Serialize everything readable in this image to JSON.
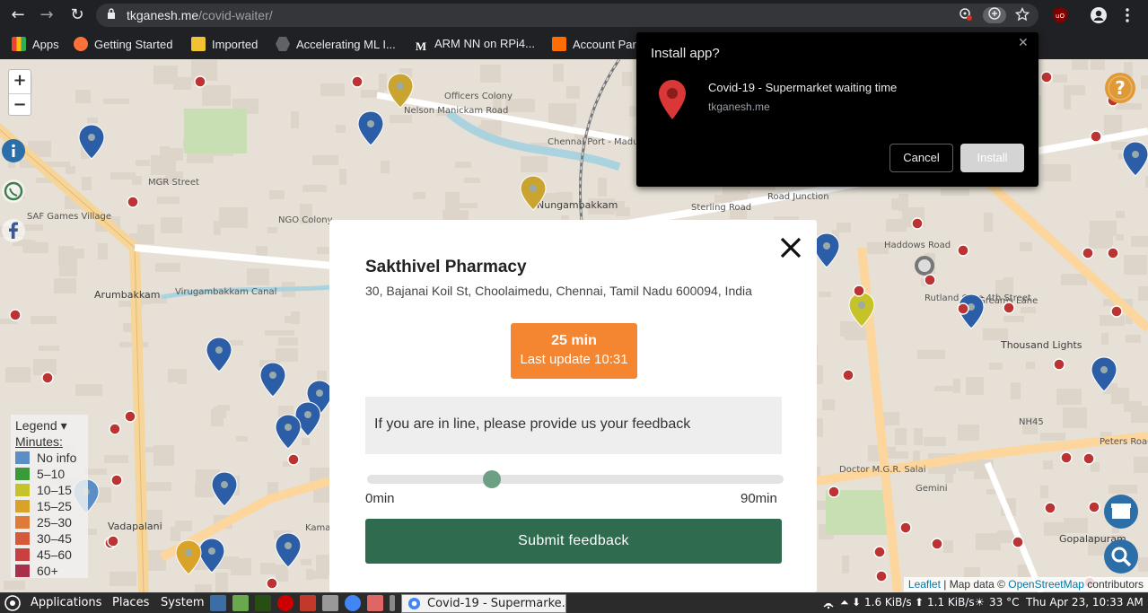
{
  "browser": {
    "url_domain": "tkganesh.me",
    "url_path": "/covid-waiter/",
    "nav": {
      "back": "←",
      "forward": "→",
      "reload": "↻"
    },
    "bookmarks": [
      {
        "label": "Apps",
        "color": "#e8eaed"
      },
      {
        "label": "Getting Started",
        "color": "#ff7139"
      },
      {
        "label": "Imported",
        "color": "#f1c232"
      },
      {
        "label": "Accelerating ML I...",
        "color": "#9aa0a6"
      },
      {
        "label": "ARM NN on RPi4...",
        "color": "#ffffff"
      },
      {
        "label": "Account Par",
        "color": "#ff6d00"
      }
    ]
  },
  "map": {
    "zoom_in": "+",
    "zoom_out": "−",
    "labels": [
      "Officers Colony",
      "Nelson Manickam Road",
      "Chennai Port - Maduravoyal Elevated Expressway",
      "MGR Street",
      "NGO Colony",
      "Nungambakkam",
      "Sterling Road",
      "Road Junction",
      "SAF Games Village",
      "Arumbakkam",
      "Virugambakkam Canal",
      "Vadapalani",
      "Doctor M.G.R. Salai",
      "Thousand Lights",
      "Gemini",
      "Gopalapuram",
      "NH45",
      "Peters Road",
      "Rutland Gate 4th Street",
      "Greams Lane",
      "Haddows Road",
      "Kamarajar"
    ],
    "legend": {
      "title": "Legend ▾",
      "subtitle": "Minutes:",
      "items": [
        {
          "label": "No info",
          "color": "#5b8ec6"
        },
        {
          "label": "5–10",
          "color": "#3a9a3a"
        },
        {
          "label": "10–15",
          "color": "#c6c32a"
        },
        {
          "label": "15–25",
          "color": "#d9a32a"
        },
        {
          "label": "25–30",
          "color": "#e07a3a"
        },
        {
          "label": "30–45",
          "color": "#d65a3a"
        },
        {
          "label": "45–60",
          "color": "#c94040"
        },
        {
          "label": "60+",
          "color": "#a8304a"
        }
      ]
    },
    "attribution": {
      "leaflet": "Leaflet",
      "sep": " | Map data © ",
      "osm": "OpenStreetMap",
      "tail": " contributors"
    }
  },
  "modal": {
    "shop_name": "Sakthivel Pharmacy",
    "address": "30, Bajanai Koil St, Choolaimedu, Chennai, Tamil Nadu 600094, India",
    "wait_time": "25 min",
    "last_update": "Last update 10:31",
    "feedback_prompt": "If you are in line, please provide us your feedback",
    "slider": {
      "min_label": "0min",
      "max_label": "90min",
      "min": 0,
      "max": 90,
      "value": 27
    },
    "submit_label": "Submit feedback",
    "close": "✕"
  },
  "install_dialog": {
    "title": "Install app?",
    "app_name": "Covid-19 - Supermarket waiting time",
    "domain": "tkganesh.me",
    "cancel_label": "Cancel",
    "install_label": "Install"
  },
  "taskbar": {
    "applications": "Applications",
    "places": "Places",
    "system": "System",
    "active_task": "Covid-19 - Supermarke...",
    "net_down": "1.6 KiB/s",
    "net_up": "1.1 KiB/s",
    "weather": "33 °C",
    "clock": "Thu Apr 23, 10:33 AM"
  }
}
